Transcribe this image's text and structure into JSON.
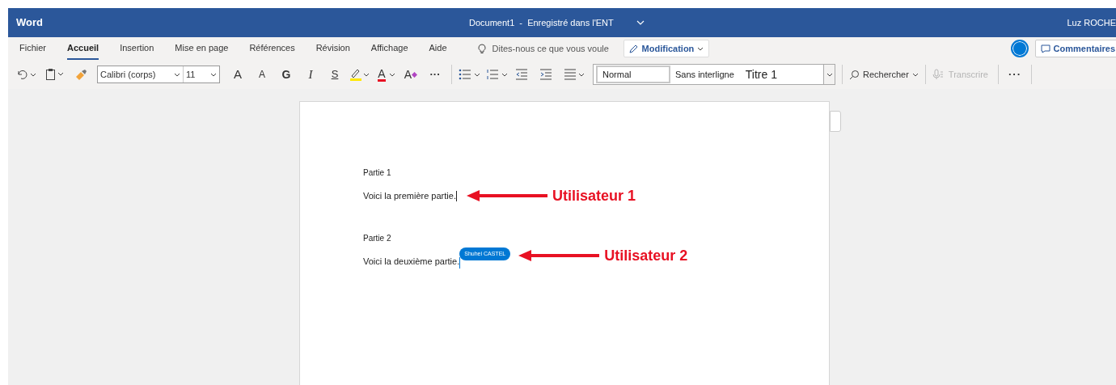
{
  "title_bar": {
    "app": "Word",
    "document": "Document1  -  Enregistré dans l'ENT",
    "user": "Luz ROCHE"
  },
  "tabs": [
    {
      "label": "Fichier",
      "selected": false
    },
    {
      "label": "Accueil",
      "selected": true
    },
    {
      "label": "Insertion",
      "selected": false
    },
    {
      "label": "Mise en page",
      "selected": false
    },
    {
      "label": "Références",
      "selected": false
    },
    {
      "label": "Révision",
      "selected": false
    },
    {
      "label": "Affichage",
      "selected": false
    },
    {
      "label": "Aide",
      "selected": false
    }
  ],
  "tell_me": {
    "placeholder": "Dites-nous ce que vous voule"
  },
  "mode_button": "Modification",
  "comments_button": "Commentaires",
  "toolbar": {
    "font": "Calibri (corps)",
    "size": "11",
    "format_buttons": [
      {
        "kind": "grow",
        "label": "A"
      },
      {
        "kind": "shrink",
        "label": "A"
      },
      {
        "kind": "bold",
        "label": "G"
      },
      {
        "kind": "italic",
        "label": "I"
      },
      {
        "kind": "underline",
        "label": "S"
      },
      {
        "kind": "highlight"
      },
      {
        "kind": "fontcolor",
        "label": "A"
      },
      {
        "kind": "clear",
        "label": "A"
      },
      {
        "kind": "more",
        "label": "···"
      }
    ],
    "styles": [
      {
        "label": "Normal",
        "selected": true
      },
      {
        "label": "Sans interligne",
        "selected": false
      },
      {
        "label": "Titre 1",
        "selected": false
      }
    ],
    "find": "Rechercher",
    "dictate": {
      "label": "Transcrire",
      "disabled": true
    },
    "more": "···"
  },
  "document": {
    "blocks": [
      {
        "heading": "Partie 1",
        "text": "Voici la première partie.",
        "annotation": "Utilisateur 1"
      },
      {
        "heading": "Partie 2",
        "text": "Voici la deuxième partie.",
        "cursor_label": "Shuhei CASTEL",
        "annotation": "Utilisateur 2"
      }
    ]
  }
}
